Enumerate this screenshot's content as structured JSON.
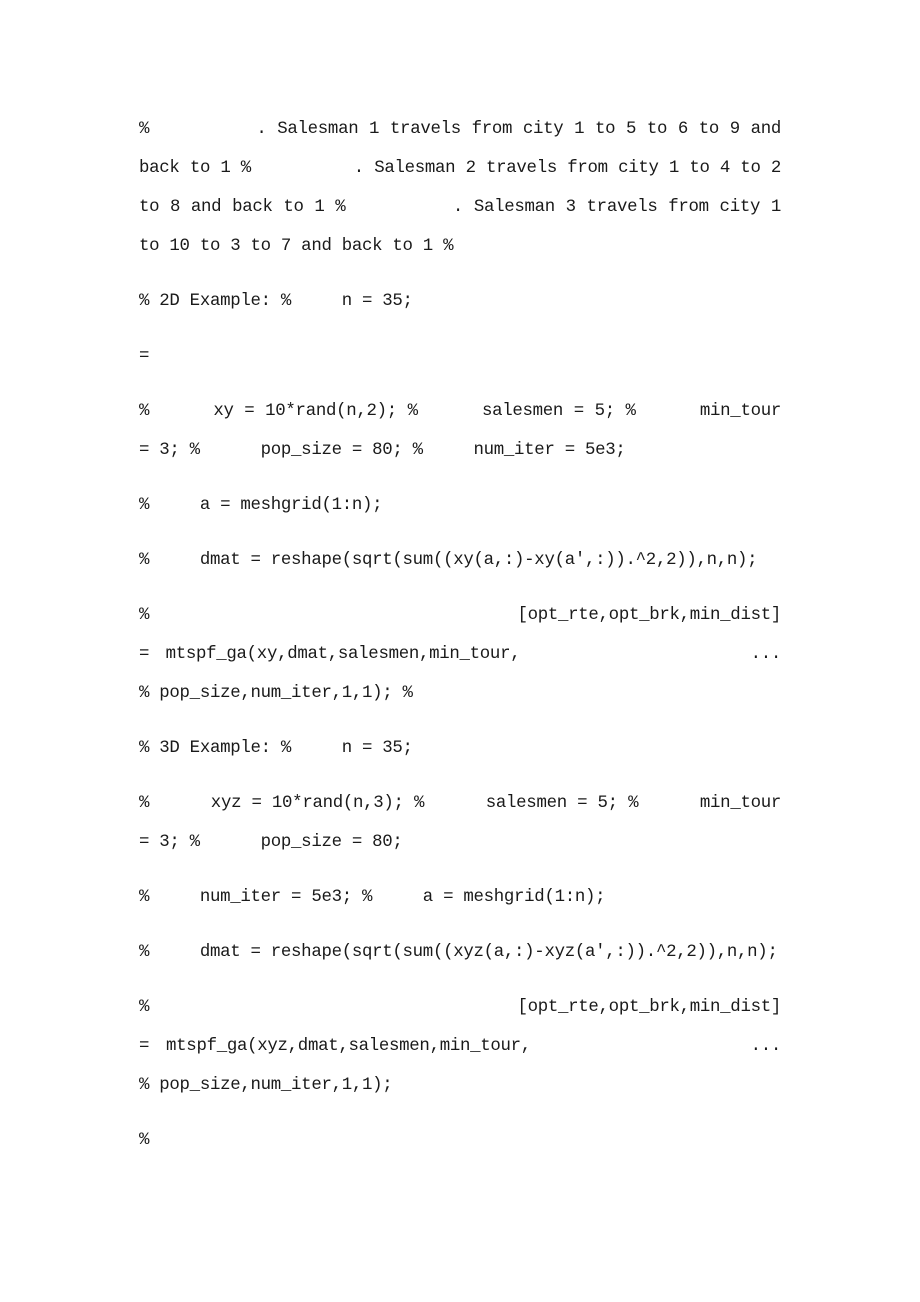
{
  "document": {
    "paragraphs": [
      "%          . Salesman 1 travels from city 1 to 5 to 6 to 9 and back to 1 %          . Salesman 2 travels from city 1 to 4 to 2 to 8 and back to 1 %          . Salesman 3 travels from city 1 to 10 to 3 to 7 and back to 1 %",
      "% 2D Example: %     n = 35;",
      "=",
      "%      xy = 10*rand(n,2); %      salesmen = 5; %      min_tour = 3; %      pop_size = 80; %     num_iter = 5e3;",
      "%     a = meshgrid(1:n);",
      "%     dmat = reshape(sqrt(sum((xy(a,:)-xy(a',:)).^2,2)),n,n);",
      "%                              [opt_rte,opt_brk,min_dist]       = mtspf_ga(xy,dmat,salesmen,min_tour,              ...              % pop_size,num_iter,1,1); %",
      "% 3D Example: %     n = 35;",
      "%      xyz = 10*rand(n,3); %      salesmen = 5; %      min_tour = 3; %      pop_size = 80;",
      "%     num_iter = 5e3; %     a = meshgrid(1:n);",
      "%     dmat = reshape(sqrt(sum((xyz(a,:)-xyz(a',:)).^2,2)),n,n);",
      "%                              [opt_rte,opt_brk,min_dist]       = mtspf_ga(xyz,dmat,salesmen,min_tour,             ...              % pop_size,num_iter,1,1);",
      "%"
    ]
  }
}
